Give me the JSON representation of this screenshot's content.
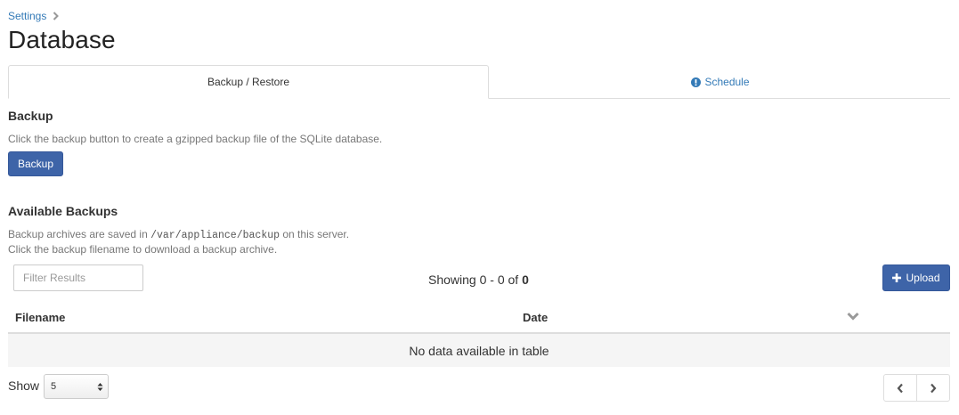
{
  "breadcrumb": {
    "label": "Settings"
  },
  "page": {
    "title": "Database"
  },
  "tabs": [
    {
      "label": "Backup / Restore",
      "active": true
    },
    {
      "label": "Schedule",
      "active": false,
      "icon": "exclamation-circle-icon"
    }
  ],
  "backup": {
    "heading": "Backup",
    "description": "Click the backup button to create a gzipped backup file of the SQLite database.",
    "button_label": "Backup"
  },
  "available": {
    "heading": "Available Backups",
    "desc_prefix": "Backup archives are saved in",
    "path": "/var/appliance/backup",
    "desc_suffix": "on this server.",
    "desc_line2": "Click the backup filename to download a backup archive."
  },
  "table": {
    "filter_placeholder": "Filter Results",
    "showing_prefix": "Showing 0 - 0 of",
    "showing_total": "0",
    "upload_label": "Upload",
    "columns": [
      "Filename",
      "Date"
    ],
    "empty_message": "No data available in table",
    "show_label": "Show",
    "page_size": "5"
  },
  "colors": {
    "primary": "#3e64a8",
    "link": "#337ab7",
    "empty_row_bg": "#f5f5f5"
  }
}
